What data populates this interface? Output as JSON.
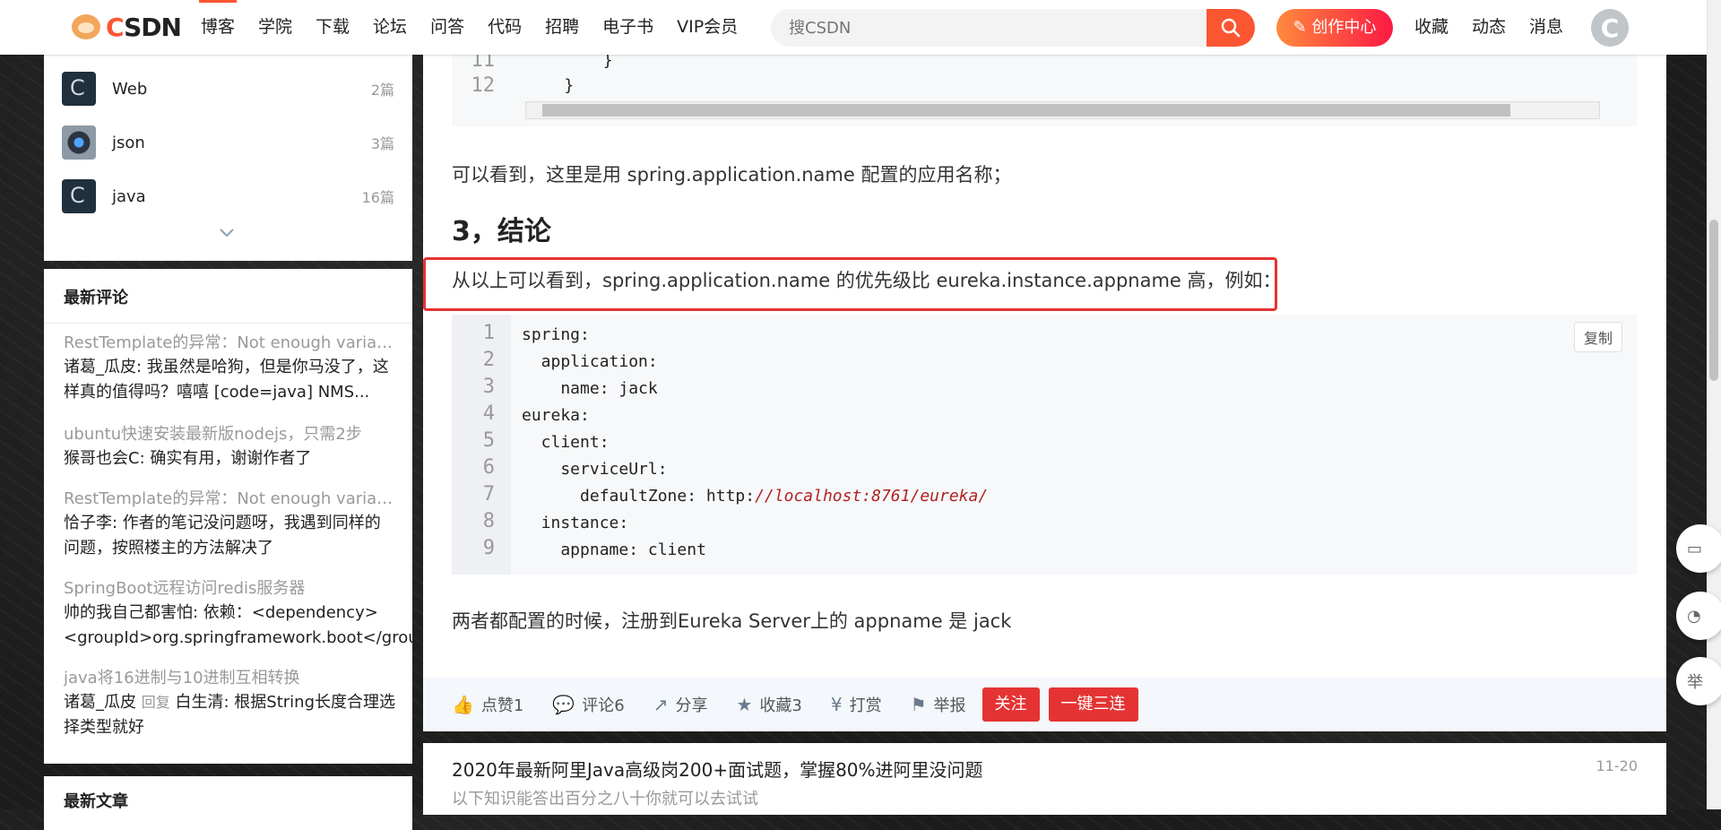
{
  "logo": {
    "text_c": "C",
    "text_rest": "SDN"
  },
  "nav": [
    "博客",
    "学院",
    "下载",
    "论坛",
    "问答",
    "代码",
    "招聘",
    "电子书",
    "VIP会员"
  ],
  "search": {
    "placeholder": "搜CSDN"
  },
  "creator": {
    "label": "创作中心"
  },
  "right_nav": [
    "收藏",
    "动态",
    "消息"
  ],
  "categories": [
    {
      "name": "Web",
      "count": "2篇"
    },
    {
      "name": "json",
      "count": "3篇"
    },
    {
      "name": "java",
      "count": "16篇"
    }
  ],
  "comments_card": {
    "title": "最新评论",
    "items": [
      {
        "title": "RestTemplate的异常：Not enough variables",
        "body": "诸葛_瓜皮: 我虽然是哈狗，但是你马没了，这样真的值得吗？嘻嘻 [code=java] NMS..."
      },
      {
        "title": "ubuntu快速安装最新版nodejs，只需2步",
        "body": "猴哥也会C: 确实有用，谢谢作者了"
      },
      {
        "title": "RestTemplate的异常：Not enough variables",
        "body": "恰子李: 作者的笔记没问题呀，我遇到同样的问题，按照楼主的方法解决了"
      },
      {
        "title": "SpringBoot远程访问redis服务器",
        "body": "帅的我自己都害怕: 依赖：<dependency> <groupId>org.springframework.boot</grou..."
      },
      {
        "title": "java将16进制与10进制互相转换",
        "body_author": "诸葛_瓜皮",
        "body_reply": "回复",
        "body_rest": "白生清: 根据String长度合理选择类型就好"
      }
    ]
  },
  "articles_card": {
    "title": "最新文章"
  },
  "code1": {
    "lines": [
      {
        "n": "11",
        "text": "        }"
      },
      {
        "n": "12",
        "text": "    }"
      }
    ]
  },
  "article": {
    "para1": "可以看到，这里是用 spring.application.name 配置的应用名称；",
    "heading": "3，结论",
    "para2": "从以上可以看到，spring.application.name 的优先级比 eureka.instance.appname 高，例如：",
    "para3": "两者都配置的时候，注册到Eureka Server上的 appname 是 jack"
  },
  "code2": {
    "copy_label": "复制",
    "lines": [
      {
        "n": "1",
        "text": "spring:"
      },
      {
        "n": "2",
        "text": "  application:"
      },
      {
        "n": "3",
        "text": "    name: jack"
      },
      {
        "n": "4",
        "text": "eureka:"
      },
      {
        "n": "5",
        "text": "  client:"
      },
      {
        "n": "6",
        "text": "    serviceUrl:"
      },
      {
        "n": "7",
        "text": "      defaultZone: http:",
        "url": "//localhost:8761/eureka/"
      },
      {
        "n": "8",
        "text": "  instance:"
      },
      {
        "n": "9",
        "text": "    appname: client"
      }
    ]
  },
  "toolbar": {
    "like": "点赞1",
    "comment": "评论6",
    "share": "分享",
    "collect": "收藏3",
    "reward": "打赏",
    "report": "举报",
    "follow": "关注",
    "triple": "一键三连"
  },
  "recommend": {
    "title": "2020年最新阿里Java高级岗200+面试题，掌握80%进阿里没问题",
    "subtitle": "以下知识能答出百分之八十你就可以去试试",
    "date": "11-20"
  },
  "float": {
    "report_glyph": "举"
  },
  "colors": {
    "brand": "#fc5531",
    "highlight": "#e53333"
  }
}
